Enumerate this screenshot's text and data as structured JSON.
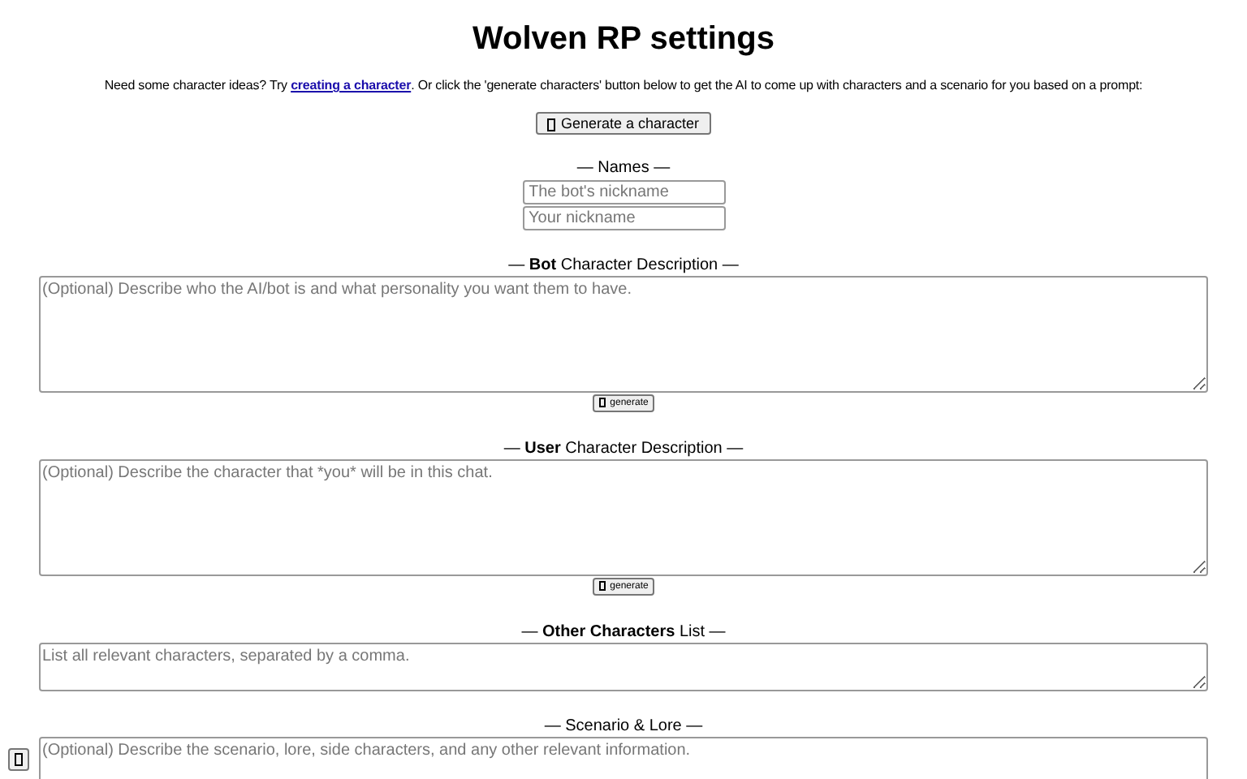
{
  "title": "Wolven RP settings",
  "intro": {
    "before": "Need some character ideas? Try",
    "link": "creating a character",
    "after": ". Or click the 'generate characters' button below to get the AI to come up with characters and a scenario for you based on a prompt:"
  },
  "generate_button": "Generate a character",
  "names": {
    "label": "— Names —",
    "fields": [
      {
        "placeholder": "The bot's nickname"
      },
      {
        "placeholder": "Your nickname"
      }
    ]
  },
  "sections": [
    {
      "label": "— **Bot** Character Description —",
      "placeholder": "(Optional) Describe who the AI/bot is and what personality you want them to have.",
      "kind": "large",
      "button": "generate"
    },
    {
      "label": "— **User** Character Description —",
      "placeholder": "(Optional) Describe the character that *you* will be in this chat.",
      "kind": "large",
      "button": "generate"
    },
    {
      "label": "— **Other Characters** List —",
      "placeholder": "List all relevant characters, separated by a comma.",
      "kind": "small"
    },
    {
      "label": "— Scenario & Lore —",
      "placeholder": "(Optional) Describe the scenario, lore, side characters, and any other relevant information.",
      "kind": "cut"
    }
  ]
}
